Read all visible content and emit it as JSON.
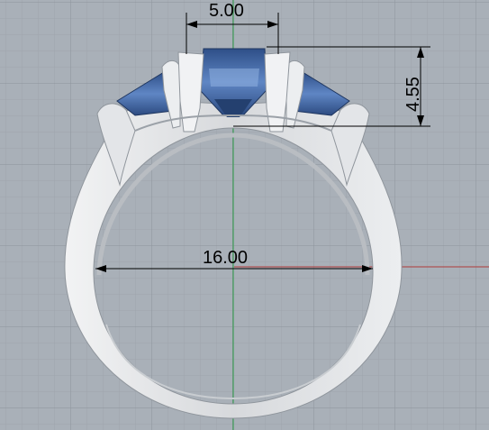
{
  "dimensions": {
    "top_width": "5.00",
    "height": "4.55",
    "ring_width": "16.00"
  },
  "colors": {
    "background": "#a9b0b8",
    "grid_minor": "#9ea5ad",
    "grid_major": "#8d949c",
    "metal": "#dfe1e4",
    "metal_shadow": "#b9bdc2",
    "stone": "#3d5f9a",
    "stone_light": "#7a9fd4",
    "axis_y": "#2f9e4a",
    "axis_x": "#b03a3a"
  }
}
